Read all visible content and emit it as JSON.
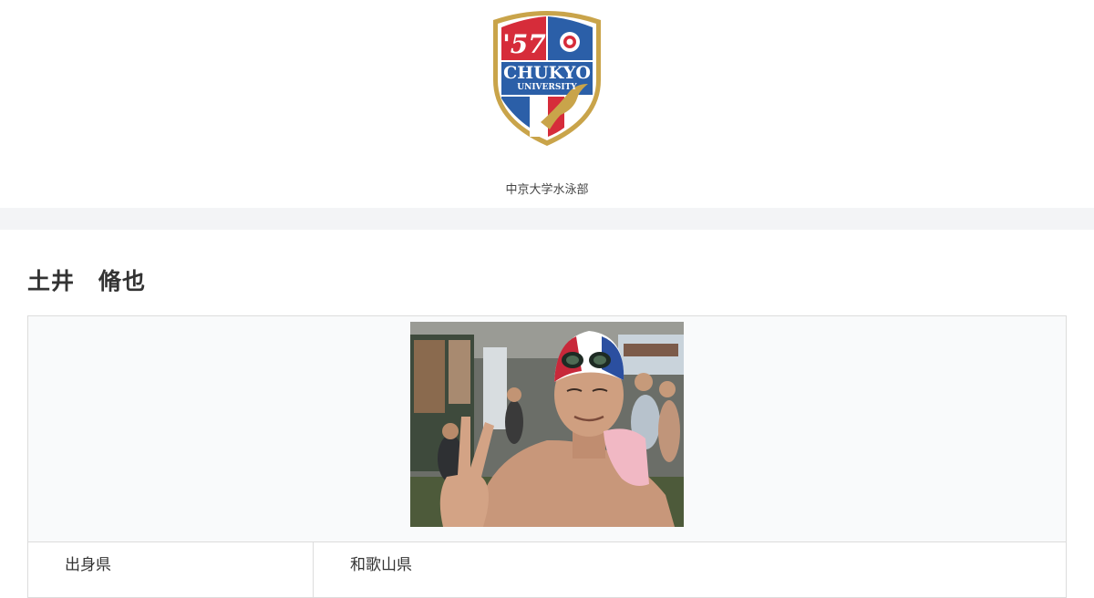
{
  "header": {
    "logo": {
      "year_text": "'57",
      "name_text": "CHUKYO",
      "sub_text": "UNIVERSITY",
      "colors": {
        "red": "#d62c3a",
        "blue": "#2b5fa8",
        "gold": "#c9a44a",
        "white": "#ffffff"
      }
    },
    "site_name": "中京大学水泳部"
  },
  "player": {
    "name": "土井　脩也",
    "photo_icon": "swimmer-photo",
    "fields": [
      {
        "label": "出身県",
        "value": "和歌山県"
      }
    ]
  }
}
